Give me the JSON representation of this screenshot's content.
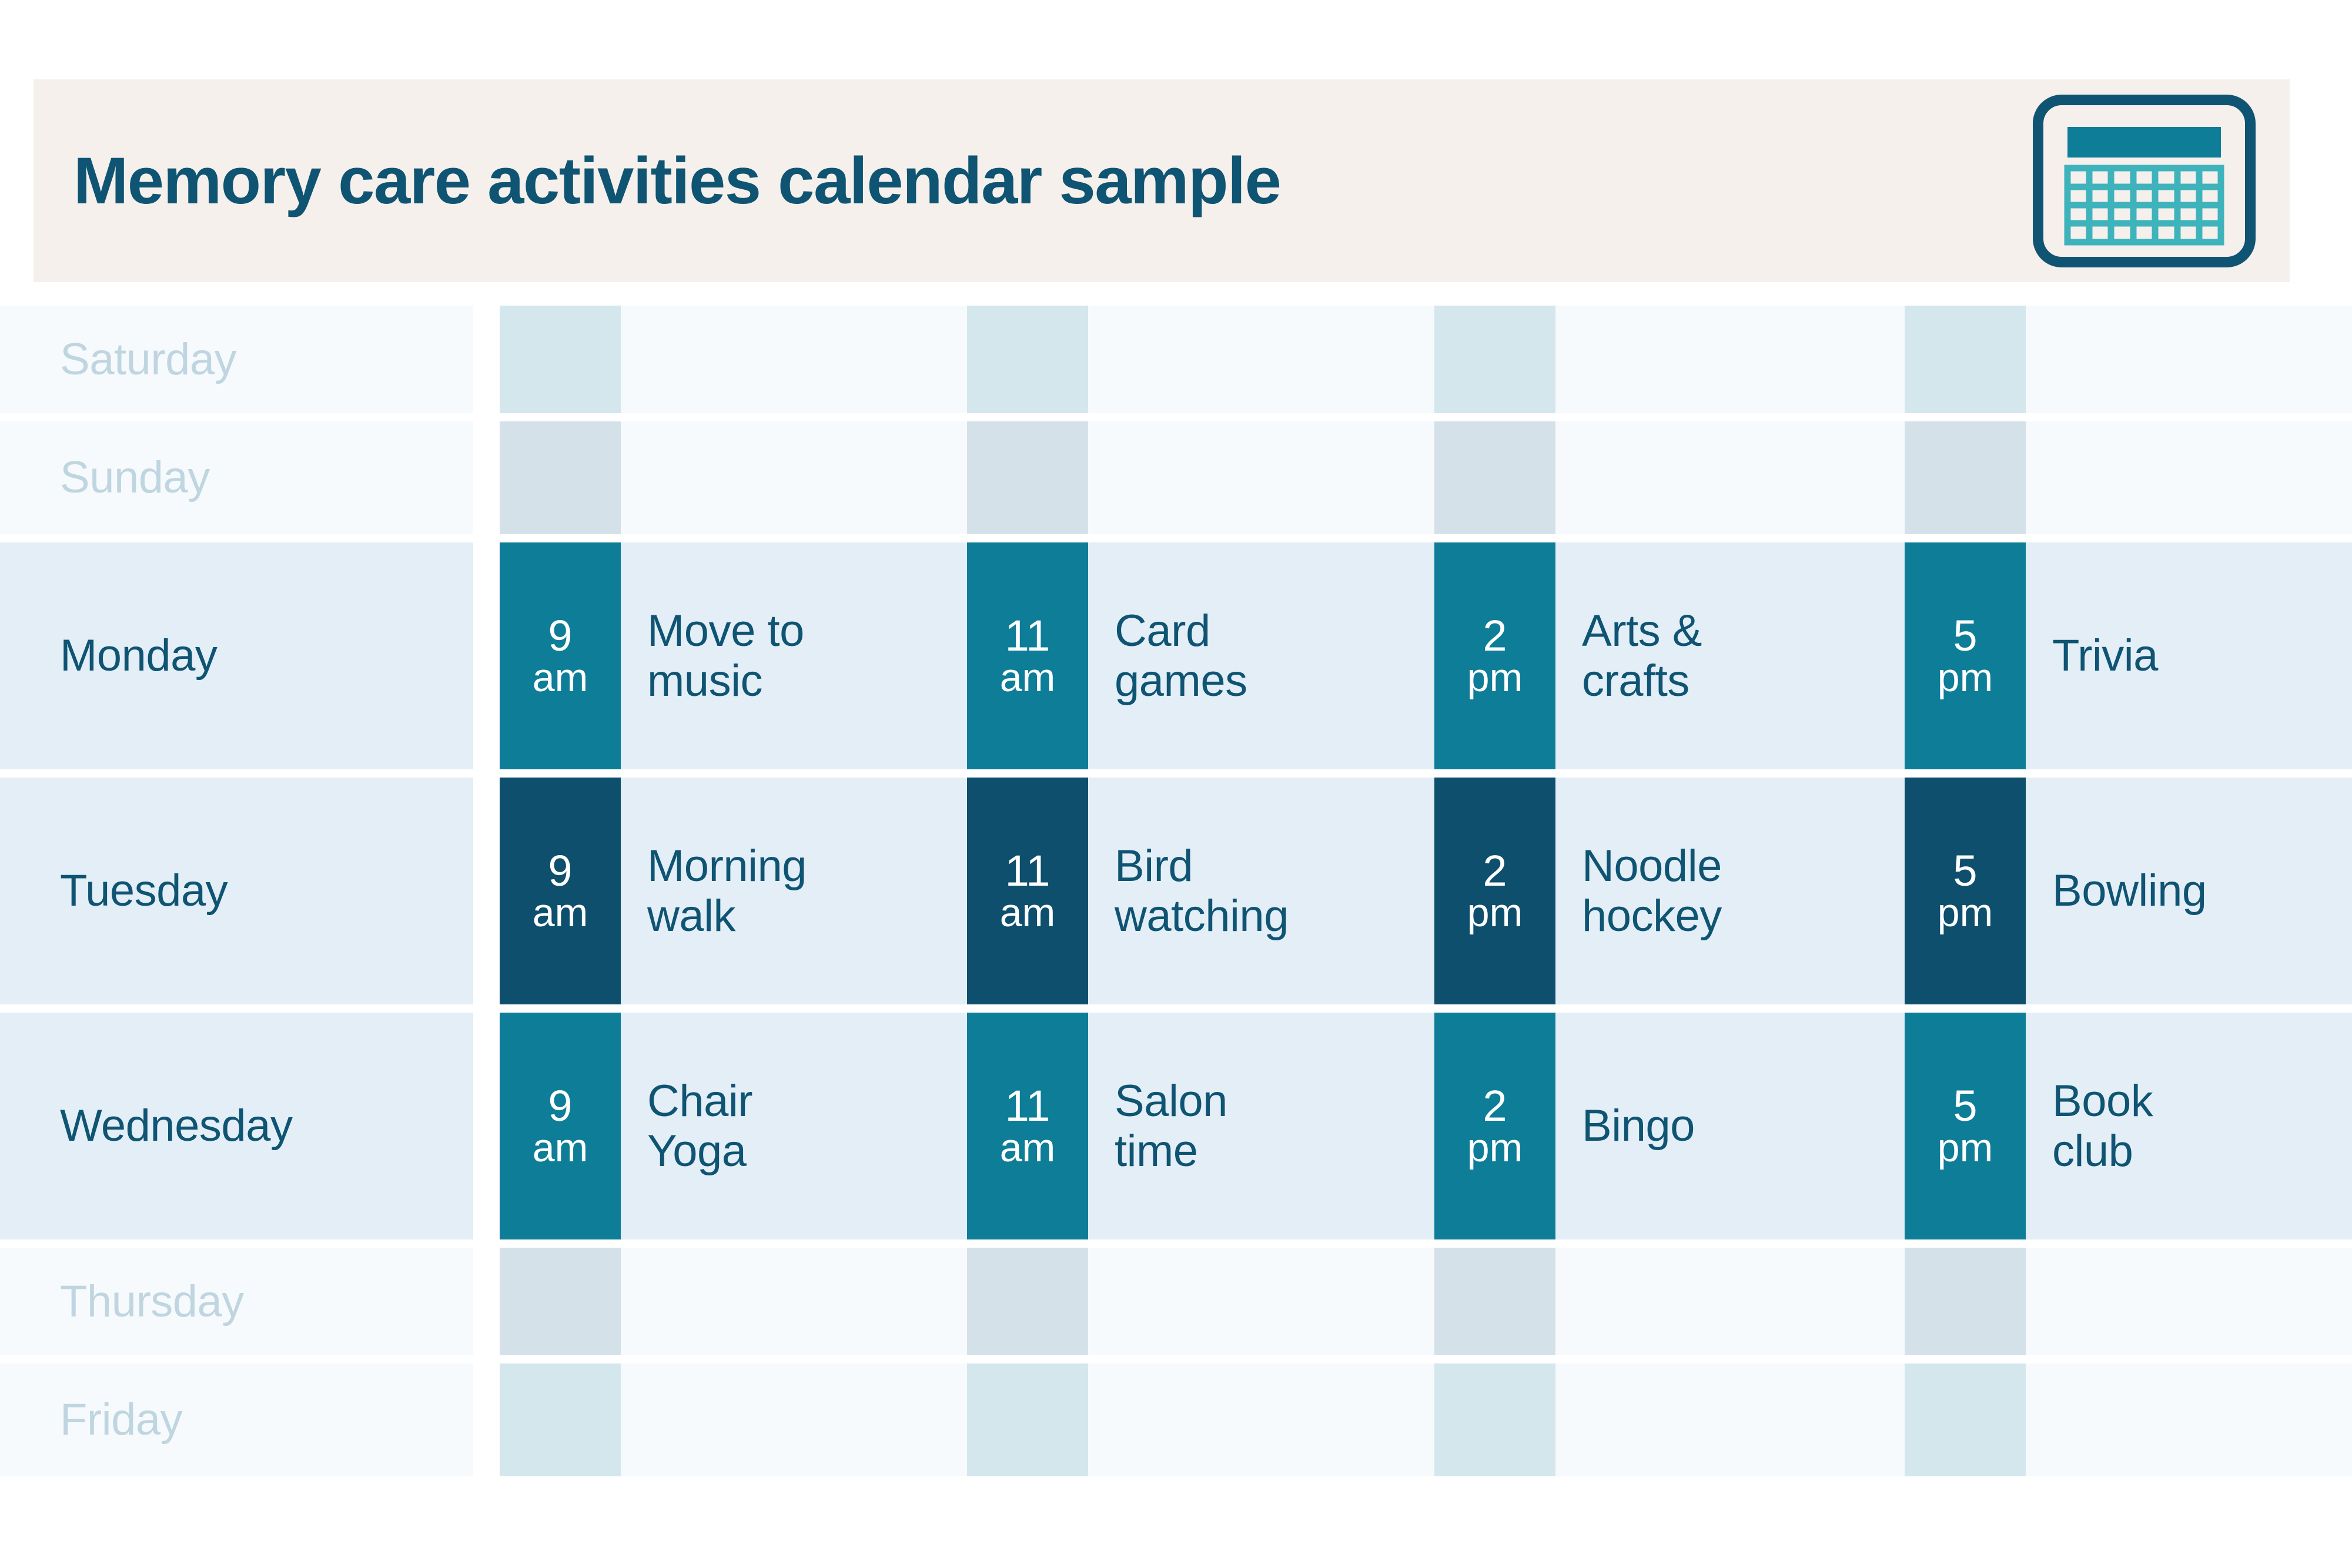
{
  "header": {
    "title": "Memory care activities calendar sample",
    "background_color": "#F5F0EB",
    "title_color": "#0F5472",
    "icon": "calendar-icon"
  },
  "colors": {
    "page_background": "#FFFFFF",
    "active_row_background": "#E3EEF7",
    "empty_row_background": "#F7FAFD",
    "badge_medium_teal": "#0D7D98",
    "badge_dark_teal": "#0D4F6C",
    "badge_ghost_cyan": "#D3E7EC",
    "badge_ghost_blue": "#D4E1E9",
    "text_dark_teal": "#0F5472",
    "text_faded": "#BFD6E0"
  },
  "calendar": {
    "rows": [
      {
        "day": "Saturday",
        "state": "empty",
        "badge_style": "ghost-cyan",
        "slots": [
          {
            "time_number": "",
            "time_meridiem": "",
            "activity": ""
          },
          {
            "time_number": "",
            "time_meridiem": "",
            "activity": ""
          },
          {
            "time_number": "",
            "time_meridiem": "",
            "activity": ""
          },
          {
            "time_number": "",
            "time_meridiem": "",
            "activity": ""
          }
        ]
      },
      {
        "day": "Sunday",
        "state": "empty",
        "badge_style": "ghost-blue",
        "slots": [
          {
            "time_number": "",
            "time_meridiem": "",
            "activity": ""
          },
          {
            "time_number": "",
            "time_meridiem": "",
            "activity": ""
          },
          {
            "time_number": "",
            "time_meridiem": "",
            "activity": ""
          },
          {
            "time_number": "",
            "time_meridiem": "",
            "activity": ""
          }
        ]
      },
      {
        "day": "Monday",
        "state": "active",
        "badge_style": "medium-teal",
        "slots": [
          {
            "time_number": "9",
            "time_meridiem": "am",
            "activity_line1": "Move to",
            "activity_line2": "music"
          },
          {
            "time_number": "11",
            "time_meridiem": "am",
            "activity_line1": "Card",
            "activity_line2": "games"
          },
          {
            "time_number": "2",
            "time_meridiem": "pm",
            "activity_line1": "Arts &",
            "activity_line2": "crafts"
          },
          {
            "time_number": "5",
            "time_meridiem": "pm",
            "activity_line1": "Trivia",
            "activity_line2": ""
          }
        ]
      },
      {
        "day": "Tuesday",
        "state": "active",
        "badge_style": "dark-teal",
        "slots": [
          {
            "time_number": "9",
            "time_meridiem": "am",
            "activity_line1": "Morning",
            "activity_line2": "walk"
          },
          {
            "time_number": "11",
            "time_meridiem": "am",
            "activity_line1": "Bird",
            "activity_line2": "watching"
          },
          {
            "time_number": "2",
            "time_meridiem": "pm",
            "activity_line1": "Noodle",
            "activity_line2": "hockey"
          },
          {
            "time_number": "5",
            "time_meridiem": "pm",
            "activity_line1": "Bowling",
            "activity_line2": ""
          }
        ]
      },
      {
        "day": "Wednesday",
        "state": "active",
        "badge_style": "medium-teal",
        "slots": [
          {
            "time_number": "9",
            "time_meridiem": "am",
            "activity_line1": "Chair",
            "activity_line2": "Yoga"
          },
          {
            "time_number": "11",
            "time_meridiem": "am",
            "activity_line1": "Salon",
            "activity_line2": "time"
          },
          {
            "time_number": "2",
            "time_meridiem": "pm",
            "activity_line1": "Bingo",
            "activity_line2": ""
          },
          {
            "time_number": "5",
            "time_meridiem": "pm",
            "activity_line1": "Book",
            "activity_line2": "club"
          }
        ]
      },
      {
        "day": "Thursday",
        "state": "empty",
        "badge_style": "ghost-blue",
        "slots": [
          {
            "time_number": "",
            "time_meridiem": "",
            "activity": ""
          },
          {
            "time_number": "",
            "time_meridiem": "",
            "activity": ""
          },
          {
            "time_number": "",
            "time_meridiem": "",
            "activity": ""
          },
          {
            "time_number": "",
            "time_meridiem": "",
            "activity": ""
          }
        ]
      },
      {
        "day": "Friday",
        "state": "empty",
        "badge_style": "ghost-cyan",
        "slots": [
          {
            "time_number": "",
            "time_meridiem": "",
            "activity": ""
          },
          {
            "time_number": "",
            "time_meridiem": "",
            "activity": ""
          },
          {
            "time_number": "",
            "time_meridiem": "",
            "activity": ""
          },
          {
            "time_number": "",
            "time_meridiem": "",
            "activity": ""
          }
        ]
      }
    ]
  }
}
